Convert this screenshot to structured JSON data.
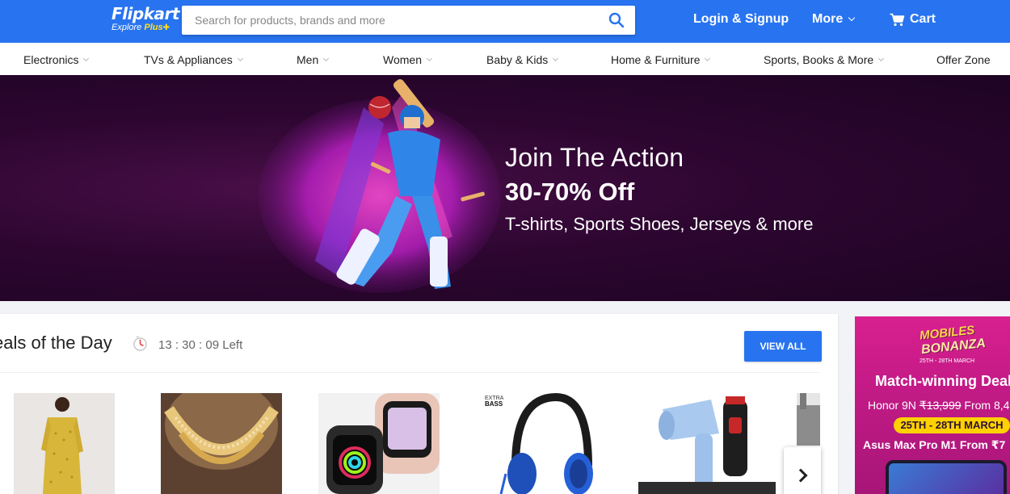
{
  "header": {
    "logo_name": "Flipkart",
    "logo_tag_explore": "Explore",
    "logo_tag_plus": "Plus",
    "search_placeholder": "Search for products, brands and more",
    "login_label": "Login & Signup",
    "more_label": "More",
    "cart_label": "Cart",
    "colors": {
      "brand": "#2874f0",
      "plus": "#ffe11b"
    }
  },
  "nav": {
    "items": [
      {
        "label": "Electronics"
      },
      {
        "label": "TVs & Appliances"
      },
      {
        "label": "Men"
      },
      {
        "label": "Women"
      },
      {
        "label": "Baby & Kids"
      },
      {
        "label": "Home & Furniture"
      },
      {
        "label": "Sports, Books & More"
      },
      {
        "label": "Offer Zone"
      }
    ]
  },
  "banner": {
    "line1": "Join The Action",
    "line2": "30-70% Off",
    "line3": "T-shirts, Sports Shoes, Jerseys & more"
  },
  "deals": {
    "title": "eals of the Day",
    "timer": "13 : 30 : 09 Left",
    "view_all": "VIEW ALL",
    "products": [
      {
        "name": "kurta-image"
      },
      {
        "name": "necklace-image"
      },
      {
        "name": "smartwatch-image"
      },
      {
        "name": "headphones-image",
        "badge": "EXTRA BASS"
      },
      {
        "name": "hair-dryer-trimmer-image"
      },
      {
        "name": "partial-product-image"
      }
    ]
  },
  "side_ad": {
    "logo_line1": "MOBILES",
    "logo_line2": "BONANZA",
    "dates_small": "25TH - 28TH MARCH",
    "headline": "Match-winning Deal",
    "line1_prefix": "Honor 9N ",
    "line1_strike": "₹13,999",
    "line1_suffix": " From 8,4",
    "pill_dates": "25TH - 28TH MARCH",
    "line2": "Asus Max Pro M1 From ₹7"
  }
}
